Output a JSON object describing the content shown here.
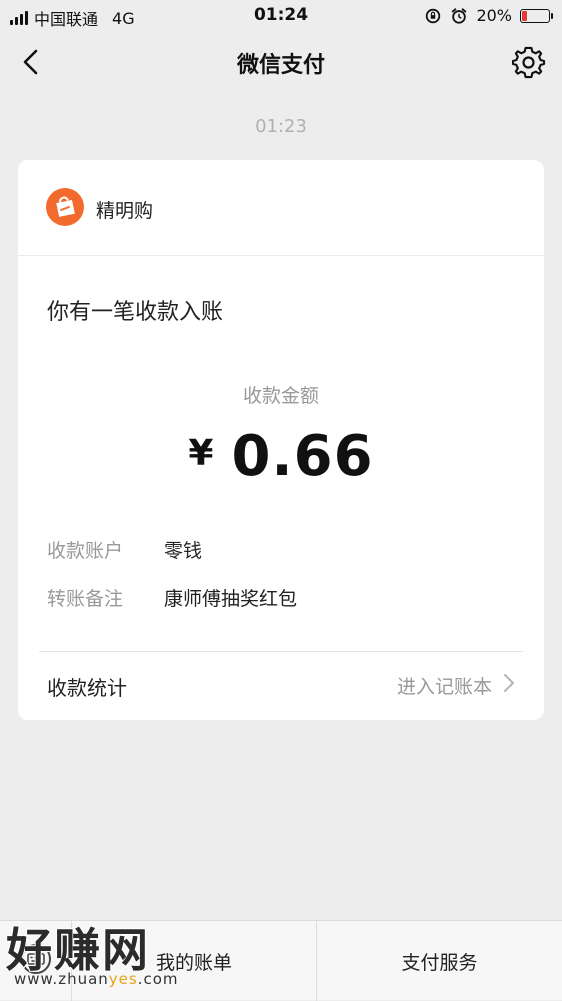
{
  "status_bar": {
    "carrier": "中国联通",
    "network": "4G",
    "time": "01:24",
    "battery_text": "20%",
    "battery_level": 0.2,
    "battery_color": "#e53935"
  },
  "nav": {
    "title": "微信支付",
    "back_icon": "chevron-left-icon",
    "settings_icon": "gear-icon"
  },
  "timestamp": "01:23",
  "card": {
    "merchant_name": "精明购",
    "merchant_logo_color": "#f26a2e",
    "title": "你有一笔收款入账",
    "amount_label": "收款金额",
    "currency_symbol": "¥",
    "amount": "0.66",
    "details": [
      {
        "label": "收款账户",
        "value": "零钱"
      },
      {
        "label": "转账备注",
        "value": "康师傅抽奖红包"
      }
    ],
    "stats_label": "收款统计",
    "stats_link": "进入记账本"
  },
  "bottom_bar": {
    "tabs": [
      {
        "label": "我的账单"
      },
      {
        "label": "支付服务"
      }
    ]
  },
  "watermark": {
    "text_big": "好赚网",
    "text_small_1": "www.zhuan",
    "text_small_2": "yes",
    "text_small_3": ".com"
  }
}
